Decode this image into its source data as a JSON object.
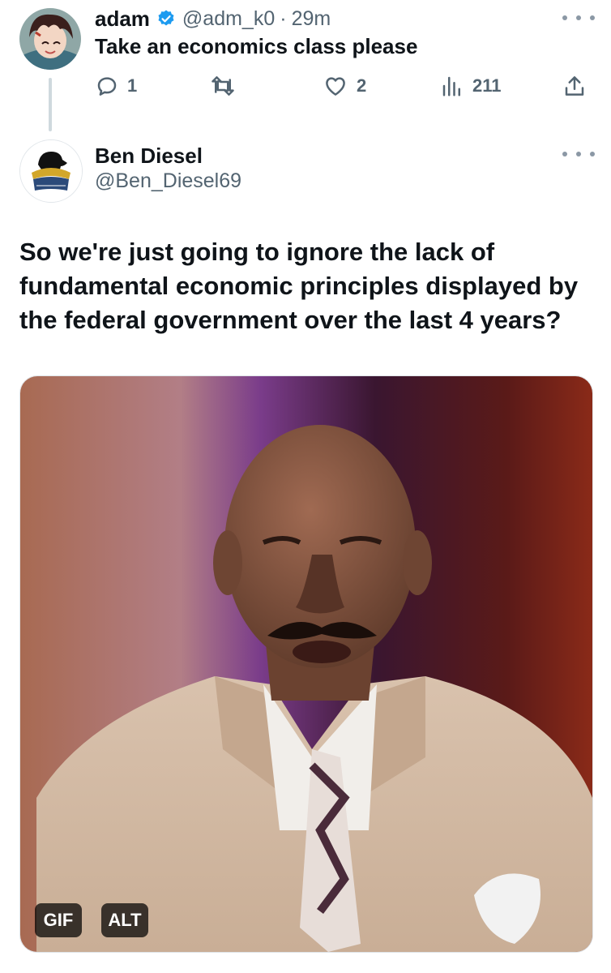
{
  "reply_tweet": {
    "author_name": "adam",
    "handle": "@adm_k0",
    "separator": "·",
    "time": "29m",
    "text": "Take an economics class please",
    "replies": "1",
    "likes": "2",
    "views": "211",
    "icons": [
      "verified-badge-icon",
      "reply-icon",
      "retweet-icon",
      "like-icon",
      "views-icon",
      "share-icon",
      "more-icon"
    ]
  },
  "quoted_tweet": {
    "author_name": "Ben Diesel",
    "handle": "@Ben_Diesel69",
    "text_lines": [
      "So we're just going to ignore the lack of",
      "fundamental economic principles displayed by",
      "the federal government over the last 4 years?"
    ],
    "media": {
      "gif_badge": "GIF",
      "alt_badge": "ALT"
    }
  },
  "colors": {
    "text": "#0f1419",
    "muted": "#536471",
    "verified": "#1d9bf0",
    "thread_line": "#cfd9de"
  }
}
